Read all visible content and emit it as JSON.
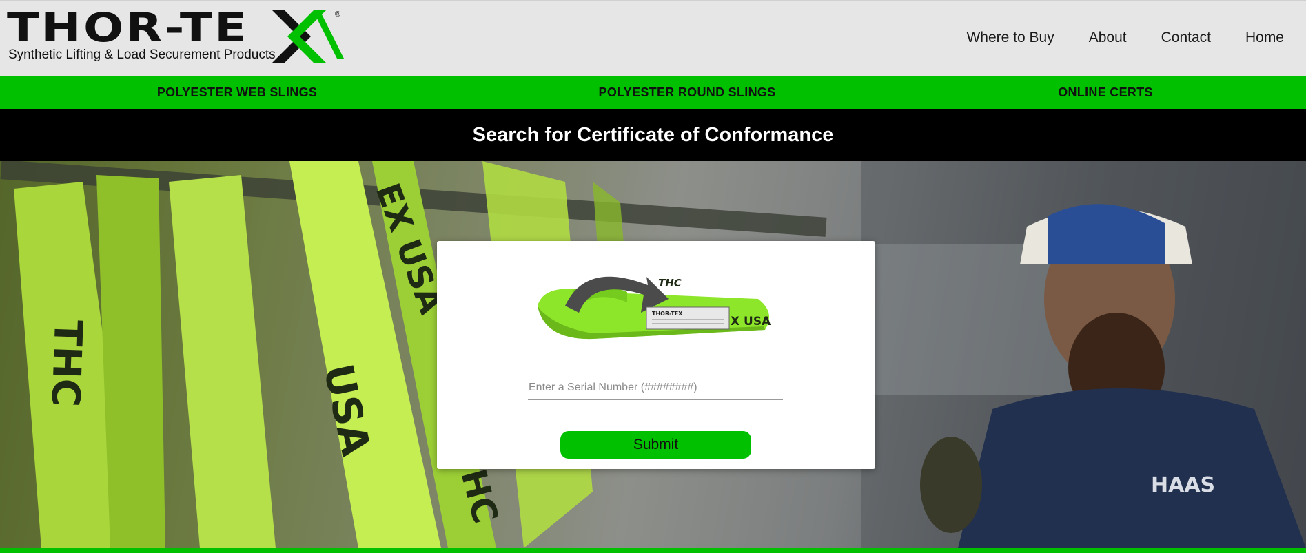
{
  "brand": {
    "name": "THOR-TEX",
    "wordmark_left": "THOR-TE",
    "registered_mark": "®",
    "tagline": "Synthetic Lifting & Load Securement Products",
    "accent_color": "#00c000"
  },
  "topnav": {
    "items": [
      {
        "label": "Where to Buy"
      },
      {
        "label": "About"
      },
      {
        "label": "Contact"
      },
      {
        "label": "Home"
      }
    ]
  },
  "product_nav": {
    "items": [
      {
        "label": "POLYESTER WEB SLINGS"
      },
      {
        "label": "POLYESTER ROUND SLINGS"
      },
      {
        "label": "ONLINE CERTS"
      }
    ]
  },
  "page": {
    "title": "Search for Certificate of Conformance"
  },
  "search": {
    "placeholder": "Enter a Serial Number (########)",
    "value": "",
    "submit_label": "Submit"
  },
  "icons": {
    "sling": "sling-tag-illustration",
    "hero": "warehouse-photo"
  }
}
